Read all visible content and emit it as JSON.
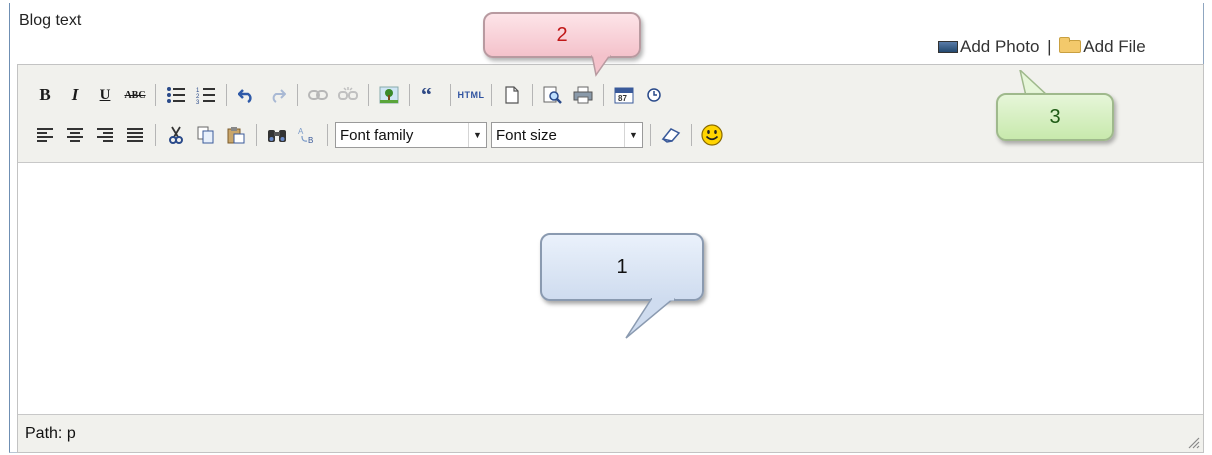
{
  "field_label": "Blog text",
  "links": {
    "add_photo": "Add Photo",
    "separator": "|",
    "add_file": "Add File"
  },
  "toolbar": {
    "row1": [
      {
        "name": "bold-button",
        "glyph": "B"
      },
      {
        "name": "italic-button",
        "glyph": "I"
      },
      {
        "name": "underline-button",
        "glyph": "U"
      },
      {
        "name": "strikethrough-button",
        "glyph": "ABC"
      },
      {
        "name": "bullet-list-button",
        "glyph": "☰"
      },
      {
        "name": "numbered-list-button",
        "glyph": "☰"
      },
      {
        "name": "undo-button",
        "glyph": "↶"
      },
      {
        "name": "redo-button",
        "glyph": "↷"
      },
      {
        "name": "link-button",
        "glyph": "⚭"
      },
      {
        "name": "unlink-button",
        "glyph": "⚮"
      },
      {
        "name": "insert-image-button",
        "glyph": "▣"
      },
      {
        "name": "blockquote-button",
        "glyph": "“"
      },
      {
        "name": "html-source-button",
        "glyph": "HTML"
      },
      {
        "name": "new-document-button",
        "glyph": "▯"
      },
      {
        "name": "preview-button",
        "glyph": "🔍"
      },
      {
        "name": "print-button",
        "glyph": "⎙"
      },
      {
        "name": "insert-date-button",
        "glyph": "▦"
      },
      {
        "name": "insert-time-button",
        "glyph": "◷"
      }
    ],
    "font_family": "Font family",
    "font_size": "Font size"
  },
  "status": {
    "path_label": "Path:",
    "path_value": "p"
  },
  "callouts": {
    "one": "1",
    "two": "2",
    "three": "3"
  },
  "colors": {
    "toolbar_bg": "#f1f1ed",
    "callout1": "#d5e2f3",
    "callout2": "#f7cfd6",
    "callout3": "#d3edbf"
  }
}
